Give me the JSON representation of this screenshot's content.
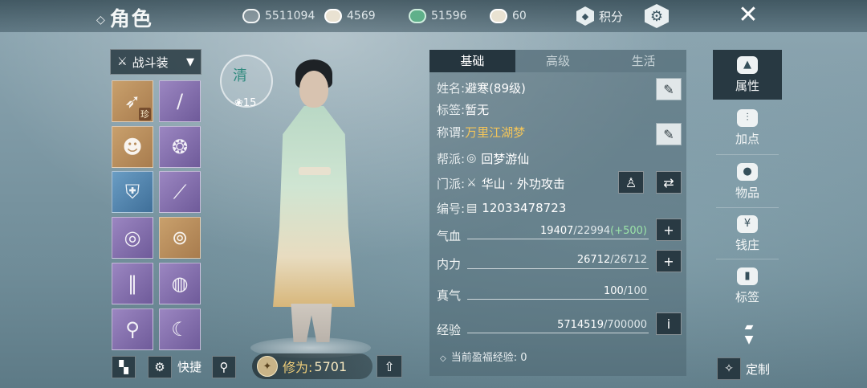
{
  "header": {
    "title": "角色",
    "resources": [
      {
        "icon": "coin-purse-icon",
        "value": "5511094"
      },
      {
        "icon": "silver-ingot-icon",
        "value": "4569"
      },
      {
        "icon": "jade-ticket-icon",
        "value": "51596"
      },
      {
        "icon": "gold-ingot-icon",
        "value": "60"
      }
    ],
    "points_label": "积分"
  },
  "equipment": {
    "dropdown_label": "战斗装",
    "slots": [
      {
        "icon": "spear-weapon-icon",
        "rarity": "orange",
        "tag": "珍"
      },
      {
        "icon": "flute-icon",
        "rarity": "purple",
        "tag": ""
      },
      {
        "icon": "hair-portrait-icon",
        "rarity": "orange",
        "tag": ""
      },
      {
        "icon": "jade-pendant-icon",
        "rarity": "purple",
        "tag": ""
      },
      {
        "icon": "armor-icon",
        "rarity": "blue",
        "tag": ""
      },
      {
        "icon": "bracer-icon",
        "rarity": "purple",
        "tag": ""
      },
      {
        "icon": "belt-icon",
        "rarity": "purple",
        "tag": ""
      },
      {
        "icon": "jade-bracelet-icon",
        "rarity": "orange",
        "tag": ""
      },
      {
        "icon": "leg-armor-icon",
        "rarity": "purple",
        "tag": ""
      },
      {
        "icon": "jade-ring-icon",
        "rarity": "purple",
        "tag": ""
      },
      {
        "icon": "boots-icon",
        "rarity": "purple",
        "tag": ""
      },
      {
        "icon": "jade-hook-icon",
        "rarity": "purple",
        "tag": ""
      }
    ],
    "quick_label": "快捷"
  },
  "character": {
    "badge_word": "清",
    "badge_level": "15",
    "cultivation_label": "修为:",
    "cultivation_value": "5701"
  },
  "info": {
    "tabs": [
      "基础",
      "高级",
      "生活"
    ],
    "active_tab": 0,
    "name_key": "姓名:",
    "name_value": "避寒(89级)",
    "tag_key": "标签:",
    "tag_value": "暂无",
    "title_key": "称谓:",
    "title_value": "万里江湖梦",
    "guild_key": "帮派:",
    "guild_value": "回梦游仙",
    "sect_key": "门派:",
    "sect_value": "华山 · 外功攻击",
    "id_key": "编号:",
    "id_value": "12033478723",
    "stats": [
      {
        "label": "气血",
        "current": "19407",
        "max": "/22994",
        "bonus": "(+500)",
        "button": "+"
      },
      {
        "label": "内力",
        "current": "26712",
        "max": "/26712",
        "bonus": "",
        "button": "+"
      },
      {
        "label": "真气",
        "current": "100",
        "max": "/100",
        "bonus": "",
        "button": ""
      },
      {
        "label": "经验",
        "current": "5714519",
        "max": "/700000",
        "bonus": "",
        "button": "i"
      }
    ],
    "fortune_text": "当前盈福经验: 0"
  },
  "right_nav": {
    "items": [
      "属性",
      "加点",
      "物品",
      "钱庄",
      "标签"
    ],
    "active": 0,
    "custom_label": "定制"
  },
  "colors": {
    "accent_gold": "#f3c55a",
    "bonus_green": "#9be3a8",
    "panel_dark": "#1e2e36"
  }
}
